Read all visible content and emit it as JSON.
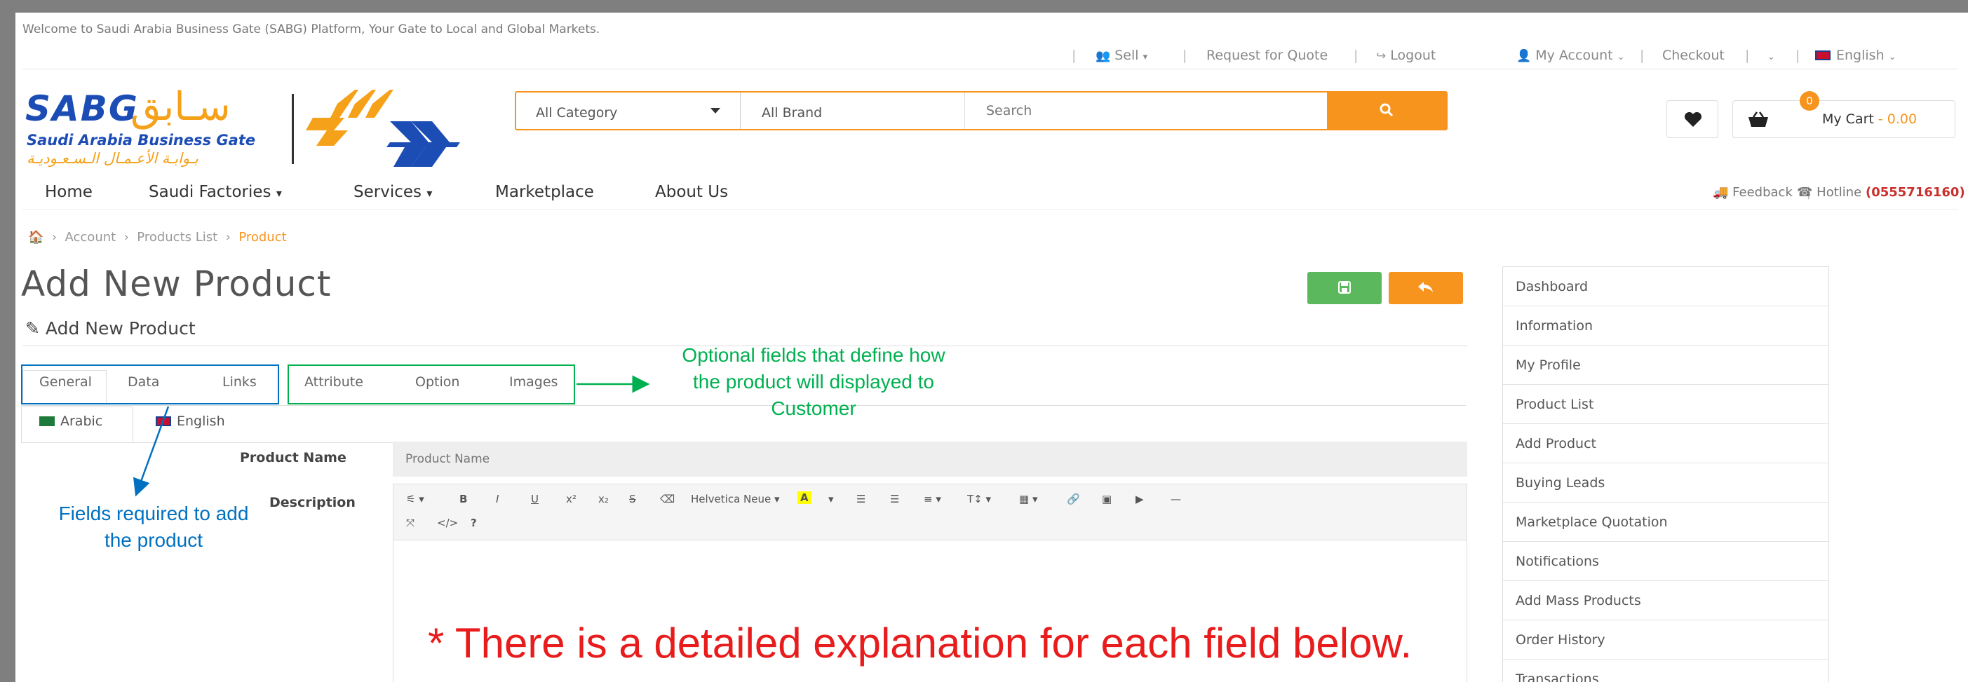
{
  "topbar": {
    "welcome": "Welcome to Saudi Arabia Business Gate (SABG) Platform, Your Gate to Local and Global Markets.",
    "sell": "Sell",
    "request_quote": "Request for Quote",
    "logout": "Logout",
    "my_account": "My Account",
    "checkout": "Checkout",
    "language": "English"
  },
  "logo": {
    "en": "SABG",
    "ar": "سـابق",
    "sub_en": "Saudi Arabia Business Gate",
    "sub_ar": "بـوابـة الأعـمـال الـسـعـوديـة"
  },
  "search": {
    "category": "All Category",
    "brand": "All Brand",
    "placeholder": "Search"
  },
  "cart": {
    "count": "0",
    "label": "My Cart",
    "amount": "- 0.00"
  },
  "nav": {
    "home": "Home",
    "factories": "Saudi Factories",
    "services": "Services",
    "marketplace": "Marketplace",
    "about": "About Us",
    "feedback": "Feedback",
    "hotline_label": "Hotline",
    "hotline_number": "(0555716160)"
  },
  "breadcrumb": {
    "account": "Account",
    "products_list": "Products List",
    "product": "Product"
  },
  "page": {
    "title": "Add New Product",
    "subtitle": "Add New Product"
  },
  "tabs": [
    "General",
    "Data",
    "Links",
    "Attribute",
    "Option",
    "Images"
  ],
  "languages": [
    "Arabic",
    "English"
  ],
  "form": {
    "product_name_label": "Product Name",
    "product_name_placeholder": "Product Name",
    "description_label": "Description",
    "font_name": "Helvetica Neue"
  },
  "menu": [
    "Dashboard",
    "Information",
    "My Profile",
    "Product List",
    "Add Product",
    "Buying Leads",
    "Marketplace Quotation",
    "Notifications",
    "Add Mass Products",
    "Order History",
    "Transactions"
  ],
  "annotations": {
    "optional": "Optional fields that define how the product will displayed to Customer",
    "required": "Fields required to add the product",
    "note": "* There is a detailed explanation for each field below."
  },
  "colors": {
    "accent": "#f7941d",
    "green": "#5cb85c",
    "annotation_blue": "#0070c0",
    "annotation_green": "#00b050",
    "annotation_red": "#e81c1c"
  }
}
